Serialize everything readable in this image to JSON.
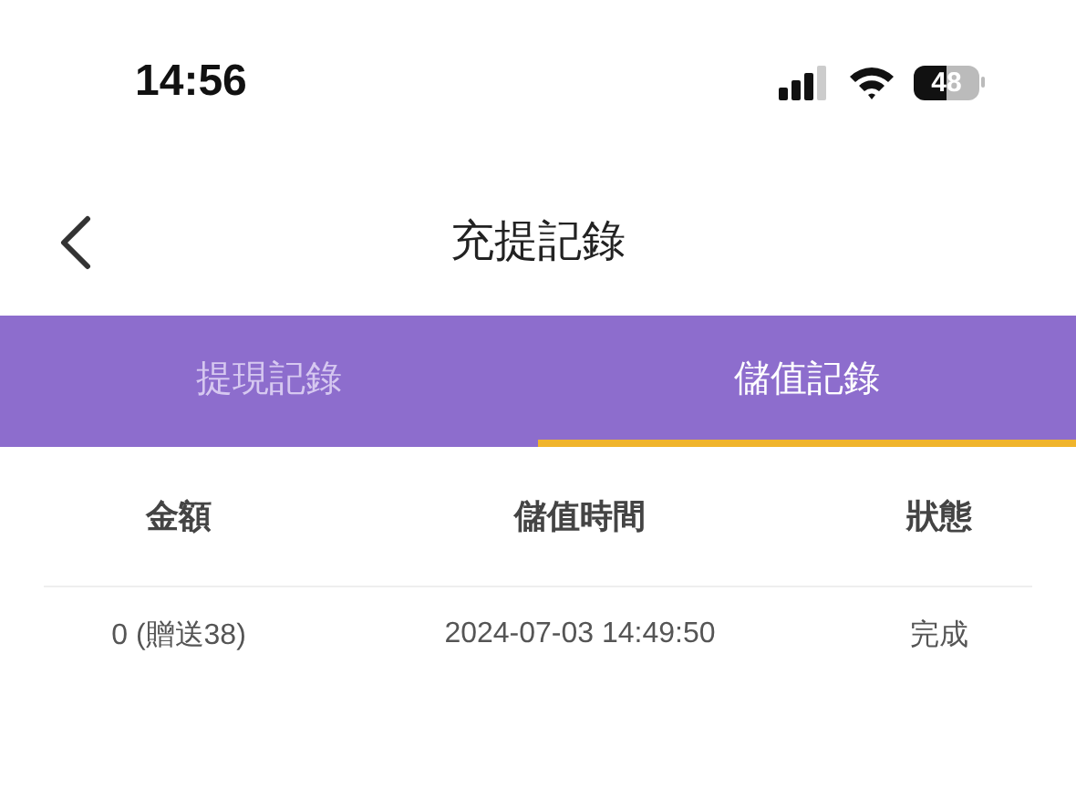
{
  "status_bar": {
    "time": "14:56",
    "battery": "48"
  },
  "header": {
    "title": "充提記錄"
  },
  "tabs": [
    {
      "label": "提現記錄",
      "selected": false
    },
    {
      "label": "儲值記錄",
      "selected": true
    }
  ],
  "table": {
    "columns": [
      "金額",
      "儲值時間",
      "狀態"
    ],
    "rows": [
      [
        "0 (贈送38)",
        "2024-07-03 14:49:50",
        "完成"
      ]
    ]
  }
}
